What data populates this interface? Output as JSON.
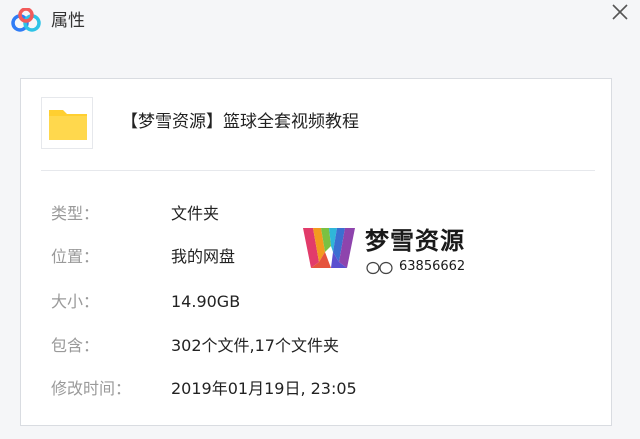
{
  "window": {
    "title": "属性"
  },
  "item": {
    "name": "【梦雪资源】篮球全套视频教程",
    "icon": "folder-icon"
  },
  "properties": [
    {
      "label": "类型：",
      "value": "文件夹"
    },
    {
      "label": "位置：",
      "value": "我的网盘"
    },
    {
      "label": "大小：",
      "value": "14.90GB"
    },
    {
      "label": "包含：",
      "value": "302个文件,17个文件夹"
    },
    {
      "label": "修改时间：",
      "value": "2019年01月19日, 23:05"
    }
  ],
  "watermark": {
    "name": "梦雪资源",
    "qq": "63856662"
  },
  "colors": {
    "folder": "#ffcf30",
    "accent_blue": "#2f7cf6"
  }
}
